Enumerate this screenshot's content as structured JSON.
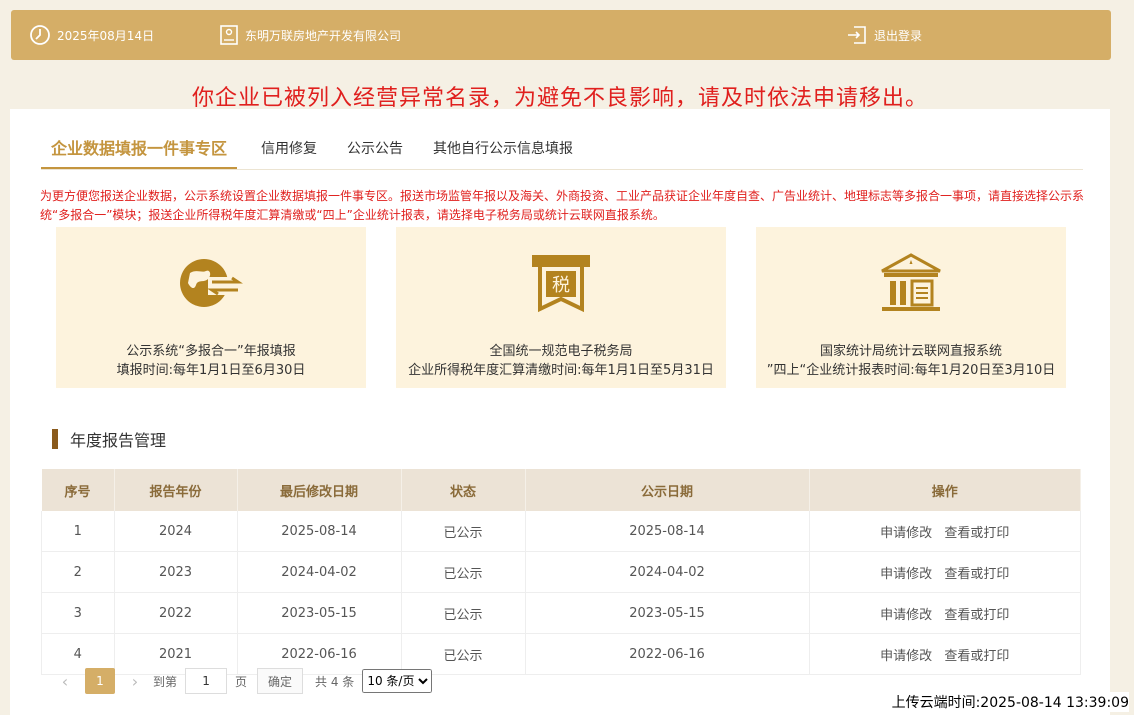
{
  "header": {
    "date": "2025年08月14日",
    "company": "东明万联房地产开发有限公司",
    "logout": "退出登录"
  },
  "warning": "你企业已被列入经营异常名录，为避免不良影响，请及时依法申请移出。",
  "tabs": [
    {
      "label": "企业数据填报一件事专区",
      "active": true
    },
    {
      "label": "信用修复"
    },
    {
      "label": "公示公告"
    },
    {
      "label": "其他自行公示信息填报"
    }
  ],
  "notice": "为更方便您报送企业数据，公示系统设置企业数据填报一件事专区。报送市场监管年报以及海关、外商投资、工业产品获证企业年度自查、广告业统计、地理标志等多报合一事项，请直接选择公示系统“多报合一”模块；报送企业所得税年度汇算清缴或“四上”企业统计报表，请选择电子税务局或统计云联网直报系统。",
  "cards": [
    {
      "icon": "globe-exchange-icon",
      "line1": "公示系统“多报合一”年报填报",
      "line2": "填报时间:每年1月1日至6月30日"
    },
    {
      "icon": "tax-icon",
      "icon_text": "税",
      "line1": "全国统一规范电子税务局",
      "line2": "企业所得税年度汇算清缴时间:每年1月1日至5月31日"
    },
    {
      "icon": "government-building-icon",
      "line1": "国家统计局统计云联网直报系统",
      "line2": "”四上“企业统计报表时间:每年1月20日至3月10日"
    }
  ],
  "section_title": "年度报告管理",
  "table": {
    "headers": [
      "序号",
      "报告年份",
      "最后修改日期",
      "状态",
      "公示日期",
      "操作"
    ],
    "rows": [
      {
        "no": "1",
        "year": "2024",
        "modified": "2025-08-14",
        "status": "已公示",
        "published": "2025-08-14"
      },
      {
        "no": "2",
        "year": "2023",
        "modified": "2024-04-02",
        "status": "已公示",
        "published": "2024-04-02"
      },
      {
        "no": "3",
        "year": "2022",
        "modified": "2023-05-15",
        "status": "已公示",
        "published": "2023-05-15"
      },
      {
        "no": "4",
        "year": "2021",
        "modified": "2022-06-16",
        "status": "已公示",
        "published": "2022-06-16"
      }
    ],
    "op_modify": "申请修改",
    "op_view": "查看或打印"
  },
  "pager": {
    "current": "1",
    "goto_label": "到第",
    "goto_value": "1",
    "page_label": "页",
    "confirm": "确定",
    "total": "共 4 条",
    "page_size": "10 条/页"
  },
  "upload_time": "上传云端时间:2025-08-14 13:39:09",
  "colors": {
    "accent": "#d5ae67",
    "warning": "#e0201e",
    "card_bg": "#fdf3dd",
    "icon": "#b3831f"
  }
}
